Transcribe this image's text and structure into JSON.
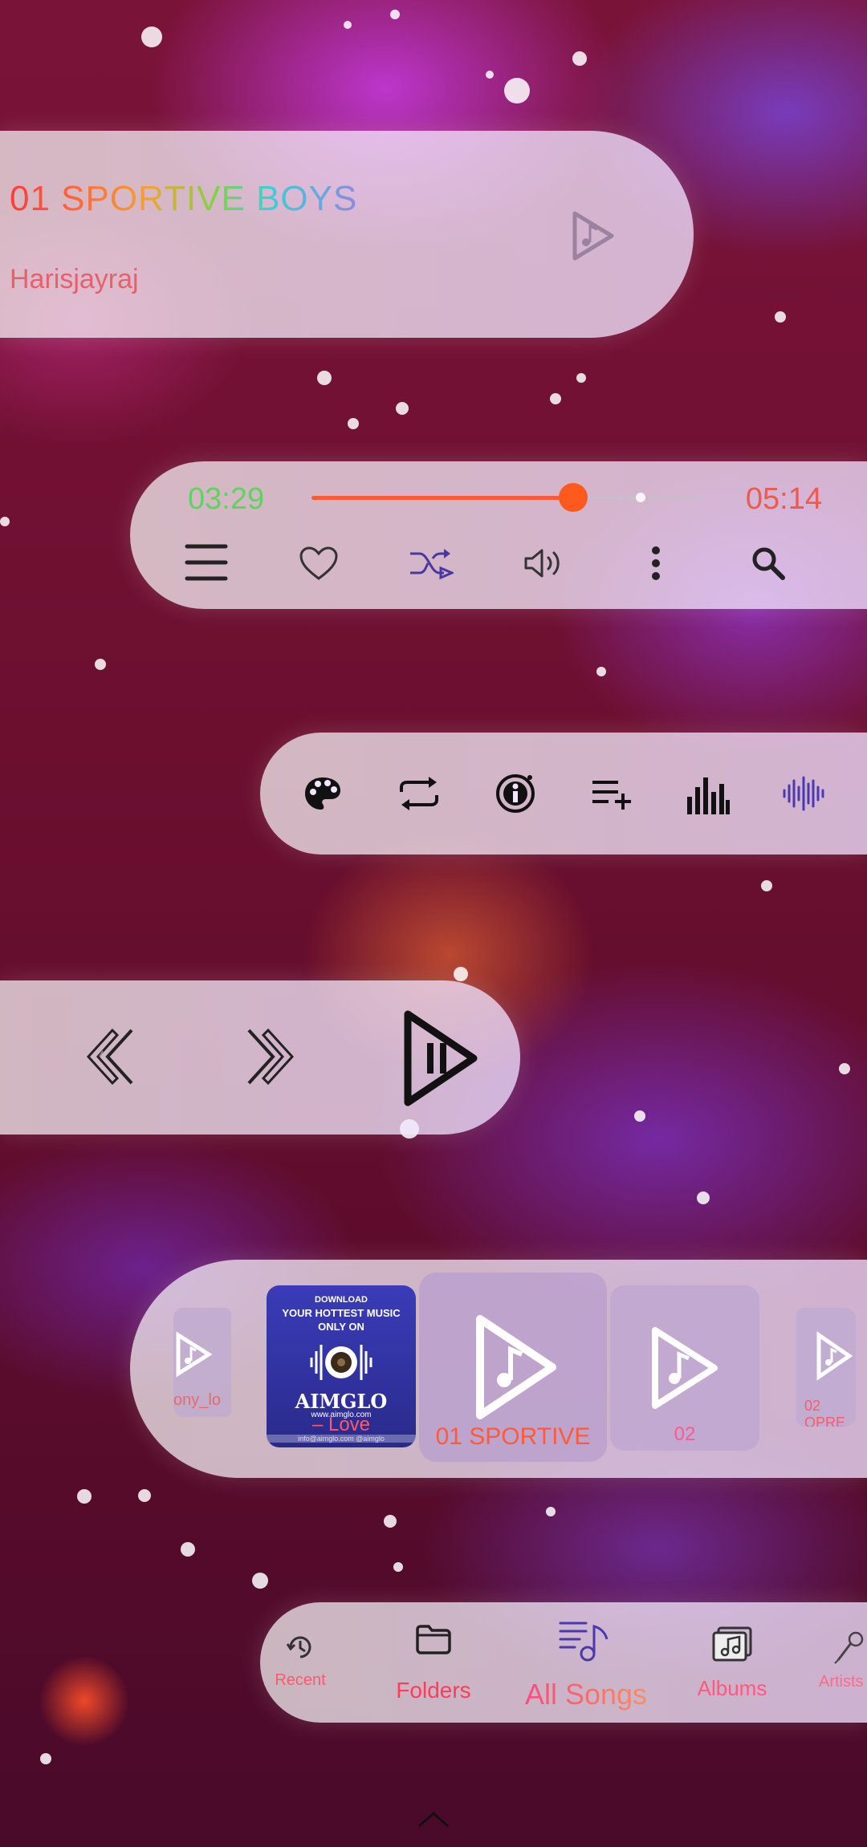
{
  "now_playing": {
    "title": "01 SPORTIVE BOYS",
    "artist": "Harisjayraj",
    "icon": "play-note-icon"
  },
  "player": {
    "current_time": "03:29",
    "total_time": "05:14",
    "progress": 0.67,
    "controls": [
      "queue-icon",
      "heart-icon",
      "shuffle-icon",
      "volume-icon",
      "more-vertical-icon",
      "search-icon"
    ]
  },
  "tools": [
    "palette-icon",
    "repeat-icon",
    "info-icon",
    "add-to-playlist-icon",
    "equalizer-icon",
    "waveform-icon"
  ],
  "transport": [
    "previous-icon",
    "next-icon",
    "play-pause-icon"
  ],
  "carousel": {
    "cards": [
      {
        "label": "ony_lo",
        "art": "play-note-icon"
      },
      {
        "label": "– Love",
        "art": "aimglo-cover",
        "cover_text": {
          "top": "DOWNLOAD",
          "line2": "YOUR HOTTEST MUSIC",
          "line3": "ONLY ON",
          "brand": "AIMGLO",
          "url": "www.aimglo.com",
          "footer": "info@aimglo.com   @aimglo"
        }
      },
      {
        "label": "01 SPORTIVE",
        "art": "play-note-icon"
      },
      {
        "label": "02",
        "art": "play-note-icon"
      },
      {
        "label": "02 OPRE",
        "art": "play-note-icon"
      }
    ]
  },
  "nav": {
    "items": [
      {
        "label": "Recent",
        "icon": "recent-icon"
      },
      {
        "label": "Folders",
        "icon": "folder-icon"
      },
      {
        "label": "All Songs",
        "icon": "music-list-icon"
      },
      {
        "label": "Albums",
        "icon": "albums-icon"
      },
      {
        "label": "Artists",
        "icon": "microphone-icon"
      }
    ]
  },
  "colors": {
    "accent": "#ff5a1e",
    "current_time": "#5fd35f",
    "total_time": "#ee5a4c",
    "nav_active": "#ff4fa0"
  }
}
